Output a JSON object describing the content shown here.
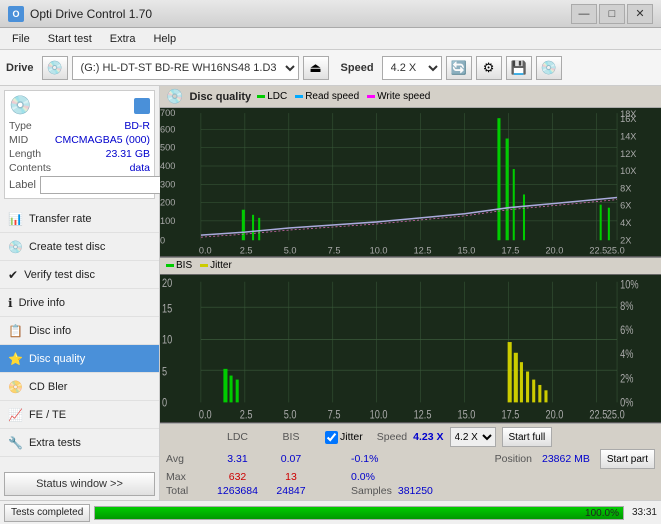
{
  "window": {
    "title": "Opti Drive Control 1.70",
    "controls": [
      "—",
      "□",
      "✕"
    ]
  },
  "menubar": {
    "items": [
      "File",
      "Start test",
      "Extra",
      "Help"
    ]
  },
  "toolbar": {
    "drive_label": "Drive",
    "drive_value": "(G:)  HL-DT-ST BD-RE  WH16NS48 1.D3",
    "speed_label": "Speed",
    "speed_value": "4.2 X"
  },
  "sidebar": {
    "disc": {
      "type_label": "Type",
      "type_value": "BD-R",
      "mid_label": "MID",
      "mid_value": "CMCMAGBA5 (000)",
      "length_label": "Length",
      "length_value": "23.31 GB",
      "contents_label": "Contents",
      "contents_value": "data",
      "label_label": "Label",
      "label_value": ""
    },
    "nav": [
      {
        "id": "transfer-rate",
        "label": "Transfer rate",
        "icon": "📊"
      },
      {
        "id": "create-test-disc",
        "label": "Create test disc",
        "icon": "💿"
      },
      {
        "id": "verify-test-disc",
        "label": "Verify test disc",
        "icon": "✔"
      },
      {
        "id": "drive-info",
        "label": "Drive info",
        "icon": "ℹ"
      },
      {
        "id": "disc-info",
        "label": "Disc info",
        "icon": "📋"
      },
      {
        "id": "disc-quality",
        "label": "Disc quality",
        "icon": "⭐",
        "active": true
      },
      {
        "id": "cd-bler",
        "label": "CD Bler",
        "icon": "📀"
      },
      {
        "id": "fe-te",
        "label": "FE / TE",
        "icon": "📈"
      },
      {
        "id": "extra-tests",
        "label": "Extra tests",
        "icon": "🔧"
      }
    ],
    "status_btn": "Status window >>"
  },
  "content": {
    "title": "Disc quality",
    "legend": [
      {
        "id": "ldc",
        "label": "LDC",
        "color": "#00cc00"
      },
      {
        "id": "read-speed",
        "label": "Read speed",
        "color": "#00aaff"
      },
      {
        "id": "write-speed",
        "label": "Write speed",
        "color": "#ff00ff"
      }
    ],
    "legend2": [
      {
        "id": "bis",
        "label": "BIS",
        "color": "#00cc00"
      },
      {
        "id": "jitter",
        "label": "Jitter",
        "color": "#cccc00"
      }
    ],
    "chart1": {
      "y_max": 700,
      "y_right_max": 18,
      "x_labels": [
        "0.0",
        "2.5",
        "5.0",
        "7.5",
        "10.0",
        "12.5",
        "15.0",
        "17.5",
        "20.0",
        "22.5",
        "25.0"
      ],
      "y_left_labels": [
        "100",
        "200",
        "300",
        "400",
        "500",
        "600",
        "700"
      ],
      "y_right_labels": [
        "2X",
        "4X",
        "6X",
        "8X",
        "10X",
        "12X",
        "14X",
        "16X",
        "18X"
      ]
    },
    "chart2": {
      "y_max": 20,
      "y_right_max": 10,
      "x_labels": [
        "0.0",
        "2.5",
        "5.0",
        "7.5",
        "10.0",
        "12.5",
        "15.0",
        "17.5",
        "20.0",
        "22.5",
        "25.0"
      ],
      "y_left_labels": [
        "5",
        "10",
        "15",
        "20"
      ],
      "y_right_labels": [
        "2%",
        "4%",
        "6%",
        "8%",
        "10%"
      ]
    },
    "stats": {
      "headers": [
        "",
        "LDC",
        "BIS",
        "",
        "Jitter",
        "Speed",
        "",
        ""
      ],
      "avg_label": "Avg",
      "avg_ldc": "3.31",
      "avg_bis": "0.07",
      "avg_jitter": "-0.1%",
      "max_label": "Max",
      "max_ldc": "632",
      "max_bis": "13",
      "max_jitter": "0.0%",
      "total_label": "Total",
      "total_ldc": "1263684",
      "total_bis": "24847",
      "speed_label": "Speed",
      "speed_value": "4.23 X",
      "position_label": "Position",
      "position_value": "23862 MB",
      "samples_label": "Samples",
      "samples_value": "381250",
      "jitter_checked": true,
      "speed_select": "4.2 X",
      "start_full_btn": "Start full",
      "start_part_btn": "Start part"
    }
  },
  "statusbar": {
    "status_btn": "Tests completed",
    "progress": 100.0,
    "progress_text": "100.0%",
    "time": "33:31"
  }
}
